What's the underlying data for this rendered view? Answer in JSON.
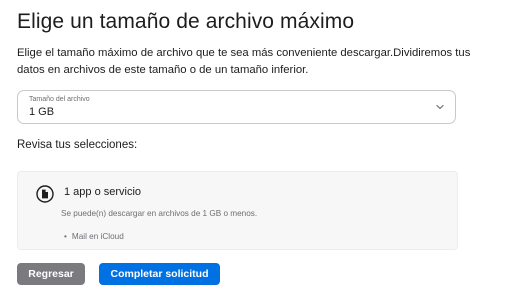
{
  "page": {
    "title": "Elige un tamaño de archivo máximo",
    "description": "Elige el tamaño máximo de archivo que te sea más conveniente descargar.Dividiremos tus datos en archivos de este tamaño o de un tamaño inferior."
  },
  "size_select": {
    "label": "Tamaño del archivo",
    "value": "1 GB",
    "icon": "chevron-down-icon"
  },
  "review": {
    "heading": "Revisa tus selecciones:"
  },
  "selection_card": {
    "icon": "document-icon",
    "service_count": "1 app o servicio",
    "note": "Se puede(n) descargar en archivos de 1 GB o menos.",
    "items": [
      "Mail en iCloud"
    ]
  },
  "actions": {
    "back_label": "Regresar",
    "submit_label": "Completar solicitud"
  },
  "colors": {
    "primary": "#0071e3",
    "secondary_button": "#7a7a7f",
    "card_background": "#f7f7f8"
  }
}
